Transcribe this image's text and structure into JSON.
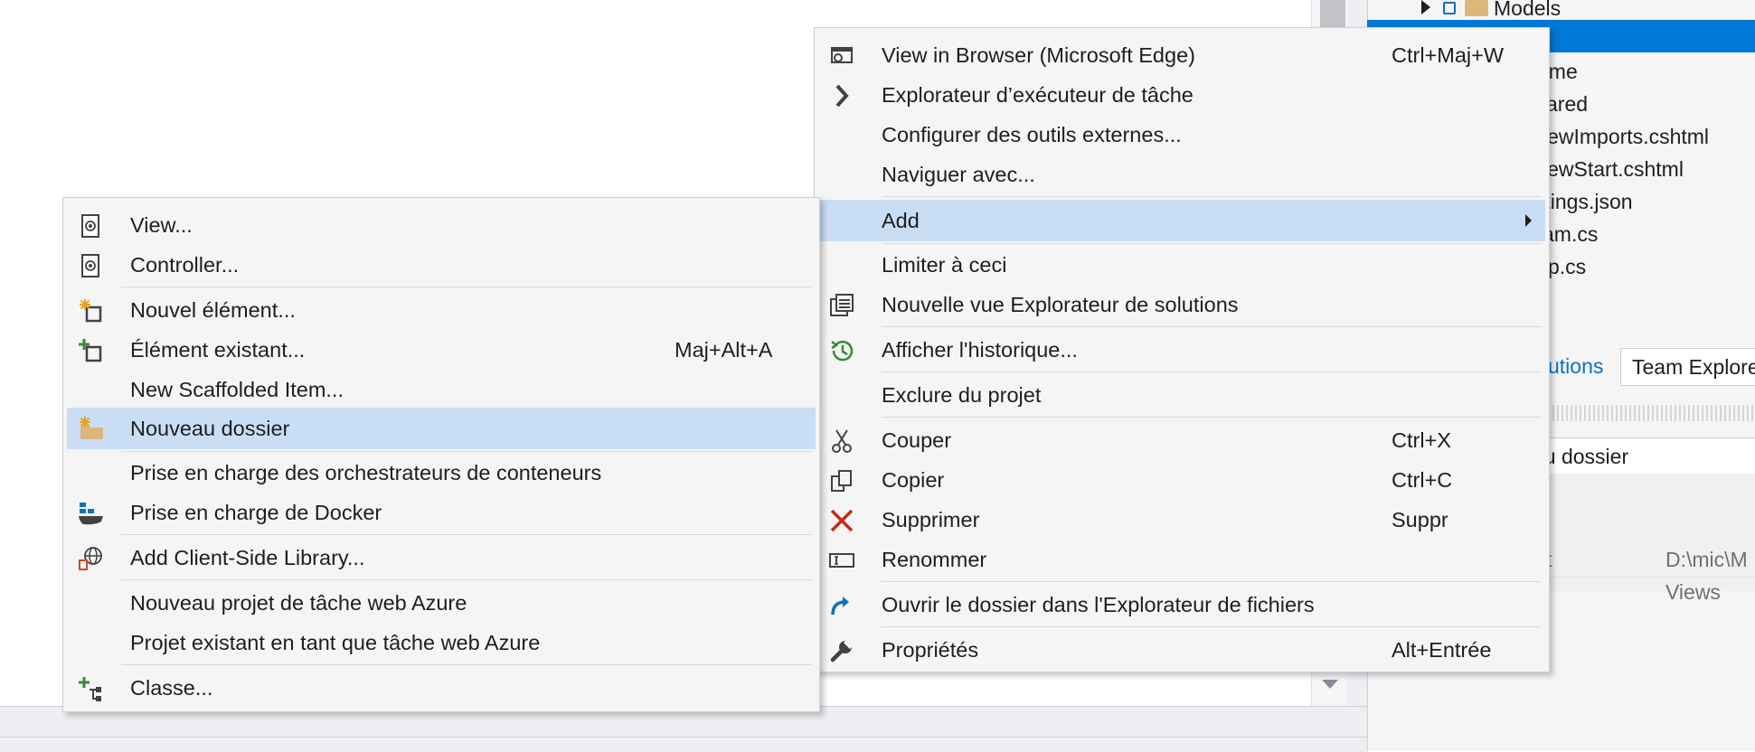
{
  "solution_explorer": {
    "models_label": "Models",
    "partial_items": [
      "ome",
      "ared",
      "iewImports.cshtml",
      "iewStart.cshtml",
      "ttings.json",
      "am.cs",
      "p.cs"
    ],
    "tabs": {
      "solutions": "utions",
      "team_explorer": "Team Explore"
    }
  },
  "properties": {
    "field_value": "du dossier",
    "row1_name": "t",
    "row1_value": "D:\\mic\\M",
    "row2_value": "Views"
  },
  "context_menu": {
    "items": [
      {
        "label": "View in Browser (Microsoft Edge)",
        "shortcut": "Ctrl+Maj+W",
        "icon": "browser-icon"
      },
      {
        "label": "Explorateur d’exécuteur de tâche",
        "icon": "chevron-right-icon"
      },
      {
        "label": "Configurer des outils externes..."
      },
      {
        "label": "Naviguer avec..."
      },
      {
        "label": "Add",
        "submenu": true
      },
      {
        "label": "Limiter à ceci"
      },
      {
        "label": "Nouvelle vue Explorateur de solutions",
        "icon": "new-window-icon"
      },
      {
        "label": "Afficher l'historique...",
        "icon": "history-icon"
      },
      {
        "label": "Exclure du projet"
      },
      {
        "label": "Couper",
        "shortcut": "Ctrl+X",
        "icon": "scissors-icon"
      },
      {
        "label": "Copier",
        "shortcut": "Ctrl+C",
        "icon": "copy-icon"
      },
      {
        "label": "Supprimer",
        "shortcut": "Suppr",
        "icon": "delete-icon"
      },
      {
        "label": "Renommer",
        "icon": "rename-icon"
      },
      {
        "label": "Ouvrir le dossier dans l'Explorateur de fichiers",
        "icon": "open-folder-arrow-icon"
      },
      {
        "label": "Propriétés",
        "shortcut": "Alt+Entrée",
        "icon": "wrench-icon"
      }
    ]
  },
  "add_submenu": {
    "items": [
      {
        "label": "View...",
        "icon": "razor-file-icon"
      },
      {
        "label": "Controller...",
        "icon": "razor-file-icon"
      },
      {
        "label": "Nouvel élément...",
        "icon": "new-item-icon"
      },
      {
        "label": "Élément existant...",
        "shortcut": "Maj+Alt+A",
        "icon": "existing-item-icon"
      },
      {
        "label": "New Scaffolded Item..."
      },
      {
        "label": "Nouveau dossier",
        "icon": "new-folder-icon"
      },
      {
        "label": "Prise en charge des orchestrateurs de conteneurs"
      },
      {
        "label": "Prise en charge de Docker",
        "icon": "docker-icon"
      },
      {
        "label": "Add Client-Side Library...",
        "icon": "globe-icon"
      },
      {
        "label": "Nouveau projet de tâche web Azure"
      },
      {
        "label": "Projet existant en tant que tâche web Azure"
      },
      {
        "label": "Classe...",
        "icon": "class-icon"
      }
    ]
  },
  "colors": {
    "menu_bg": "#f5f5f5",
    "highlight": "#c9def5",
    "selection_blue": "#0078d7",
    "accent_blue": "#0e70c0",
    "delete_red": "#c42b1c",
    "history_green": "#388a34"
  }
}
